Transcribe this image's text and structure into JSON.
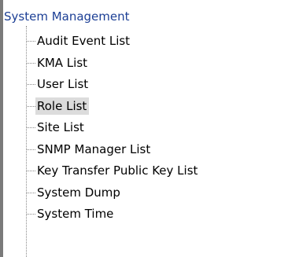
{
  "tree": {
    "root_label": "System Management",
    "items": [
      {
        "label": "Audit Event List",
        "selected": false
      },
      {
        "label": "KMA List",
        "selected": false
      },
      {
        "label": "User List",
        "selected": false
      },
      {
        "label": "Role List",
        "selected": true
      },
      {
        "label": "Site List",
        "selected": false
      },
      {
        "label": "SNMP Manager List",
        "selected": false
      },
      {
        "label": "Key Transfer Public Key List",
        "selected": false
      },
      {
        "label": "System Dump",
        "selected": false
      },
      {
        "label": "System Time",
        "selected": false
      }
    ]
  },
  "colors": {
    "root_text": "#1c3f95",
    "item_text": "#000000",
    "selection_bg": "#dcdcdc",
    "tree_lines": "#8a8a8a"
  }
}
